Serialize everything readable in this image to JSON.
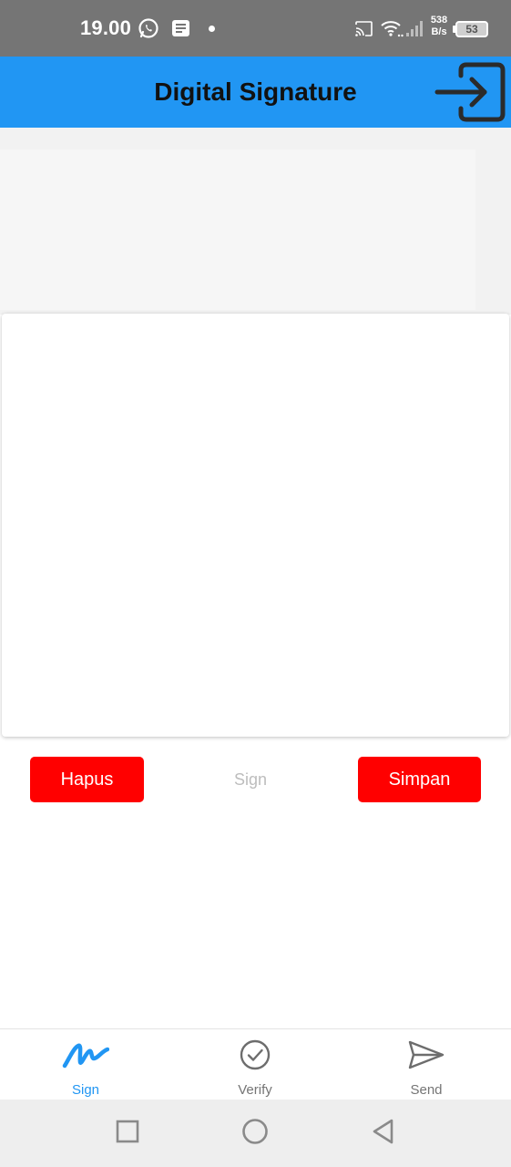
{
  "status_bar": {
    "time": "19.00",
    "net_speed_value": "538",
    "net_speed_unit": "B/s",
    "battery": "53",
    "icons": [
      "whatsapp-icon",
      "message-icon",
      "notification-dot",
      "cast-icon",
      "wifi-icon",
      "signal-icon",
      "battery-icon"
    ]
  },
  "app_bar": {
    "title": "Digital Signature",
    "action_icon": "login-icon",
    "color": "#2196F3"
  },
  "actions": {
    "clear_label": "Hapus",
    "sign_hint": "Sign",
    "save_label": "Simpan",
    "button_color": "#ff0000"
  },
  "bottom_nav": {
    "items": [
      {
        "label": "Sign",
        "icon": "signature-icon",
        "active": true
      },
      {
        "label": "Verify",
        "icon": "check-circle-icon",
        "active": false
      },
      {
        "label": "Send",
        "icon": "send-icon",
        "active": false
      }
    ],
    "active_color": "#2196F3"
  },
  "system_nav": {
    "icons": [
      "recents-square-icon",
      "home-circle-icon",
      "back-triangle-icon"
    ]
  }
}
